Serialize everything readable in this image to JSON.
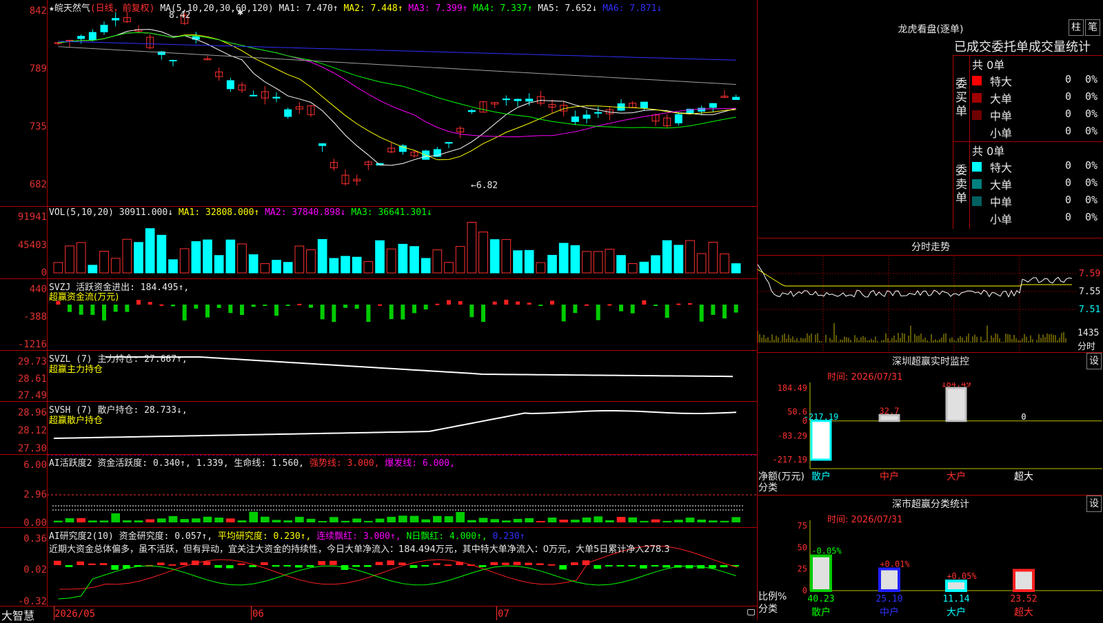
{
  "stock": {
    "star": "★",
    "name": "皖天然气",
    "mode": "(日线，前复权)"
  },
  "ma_header": {
    "label": "MA(5,10,20,30,60,120)",
    "ma1": "MA1: 7.470↑",
    "ma2": "MA2: 7.448↑",
    "ma3": "MA3: 7.399↑",
    "ma4": "MA4: 7.337↑",
    "ma5": "MA5: 7.652↓",
    "ma6": "MA6: 7.871↓",
    "colors": {
      "ma1": "#ffffff",
      "ma2": "#ffff00",
      "ma3": "#ff00ff",
      "ma4": "#00ff00",
      "ma5": "#c0c0c0",
      "ma6": "#3030ff"
    }
  },
  "price_axis": [
    "842",
    "789",
    "735",
    "682"
  ],
  "price_marks": {
    "high": "8.42",
    "low": "←6.82",
    "star_marker": "✱"
  },
  "vol": {
    "label": "VOL(5,10,20)",
    "value": "30911.000↓",
    "ma1": "MA1: 32808.000↑",
    "ma2": "MA2: 37840.898↓",
    "ma3": "MA3: 36641.301↓"
  },
  "vol_axis": [
    "91941",
    "45403",
    "0"
  ],
  "svzj": {
    "line1": "SVZJ  活跃资金进出: 184.495↑,",
    "line2": "超赢资金流(万元)"
  },
  "svzj_axis": [
    "440",
    "-388",
    "-1216"
  ],
  "svzl": {
    "line1": "SVZL (7) 主力持仓: 27.667↑,",
    "line2": "超赢主力持仓"
  },
  "svzl_axis": [
    "29.73",
    "28.61",
    "27.49"
  ],
  "svsh": {
    "line1": "SVSH (7) 散户持仓: 28.733↓,",
    "line2": "超赢散户持仓"
  },
  "svsh_axis": [
    "28.96",
    "28.12",
    "27.30"
  ],
  "ai1": {
    "label": "AI活跃度2 资金活跃度: 0.340↑, 1.339,",
    "life": "生命线: 1.560,",
    "strong": "强势线: 3.000,",
    "burst": "爆发线: 6.000,"
  },
  "ai1_axis": [
    "6.00",
    "2.96",
    "0.00"
  ],
  "ai2": {
    "label": "AI研究度2(10) 资金研究度: 0.057↑,",
    "avg": "平均研究度: 0.230↑,",
    "cont": "连续飘红: 3.000↑,",
    "nday": "N日飘红: 4.000↑,",
    "last": "0.230↑",
    "comment": "近期大资金总体偏多，虽不活跃，但有异动，宜关注大资金的持续性，今日大单净流入：184.494万元，其中特大单净流入：0万元，大单5日累计净入278.3"
  },
  "ai2_axis": [
    "0.36",
    "0.02",
    "-0.32"
  ],
  "date_axis": [
    "2026/05",
    "06",
    "07"
  ],
  "logo": "大智慧",
  "right": {
    "title": "龙虎看盘(逐单)",
    "btn_zhu": "柱",
    "btn_bi": "笔",
    "tabs": "已成交委托单成交量统计",
    "buy_group": "委买单",
    "sell_group": "委卖单",
    "buy_total": "共 0单",
    "sell_total": "共 0单",
    "buy_rows": [
      {
        "label": "特大",
        "v": "0",
        "p": "0%",
        "color": "#ff0000"
      },
      {
        "label": "大单",
        "v": "0",
        "p": "0%",
        "color": "#a00000"
      },
      {
        "label": "中单",
        "v": "0",
        "p": "0%",
        "color": "#700000"
      },
      {
        "label": "小单",
        "v": "0",
        "p": "0%",
        "color": "#000000"
      }
    ],
    "sell_rows": [
      {
        "label": "特大",
        "v": "0",
        "p": "0%",
        "color": "#00ffff"
      },
      {
        "label": "大单",
        "v": "0",
        "p": "0%",
        "color": "#008080"
      },
      {
        "label": "中单",
        "v": "0",
        "p": "0%",
        "color": "#006060"
      },
      {
        "label": "小单",
        "v": "0",
        "p": "0%",
        "color": "#000000"
      }
    ],
    "intraday": {
      "title": "分时走势",
      "axis": [
        "7.59",
        "7.55",
        "7.51"
      ],
      "vol_max": "1435",
      "vol_label": "分时"
    },
    "monitor": {
      "title": "深圳超赢实时监控",
      "btn": "设",
      "time": "时间: 2026/07/31",
      "axis": [
        "184.49",
        "50.6",
        "0",
        "-83.29",
        "-217.19"
      ],
      "values": [
        "-217.19",
        "32.7",
        "184.49",
        "0"
      ],
      "ylabel": "净额(万元)",
      "xlabel": "分类",
      "cats": [
        "散户",
        "中户",
        "大户",
        "超大"
      ]
    },
    "classify": {
      "title": "深市超赢分类统计",
      "btn": "设",
      "time": "时间: 2026/07/31",
      "axis": [
        "75",
        "50",
        "25",
        "0"
      ],
      "pct_labels": [
        "-0.05%",
        "+0.01%",
        "+0.05%",
        ""
      ],
      "values": [
        "40.23",
        "25.10",
        "11.14",
        "23.52"
      ],
      "ylabel": "比例%",
      "xlabel": "分类",
      "cats": [
        "散户",
        "中户",
        "大户",
        "超大"
      ]
    }
  }
}
